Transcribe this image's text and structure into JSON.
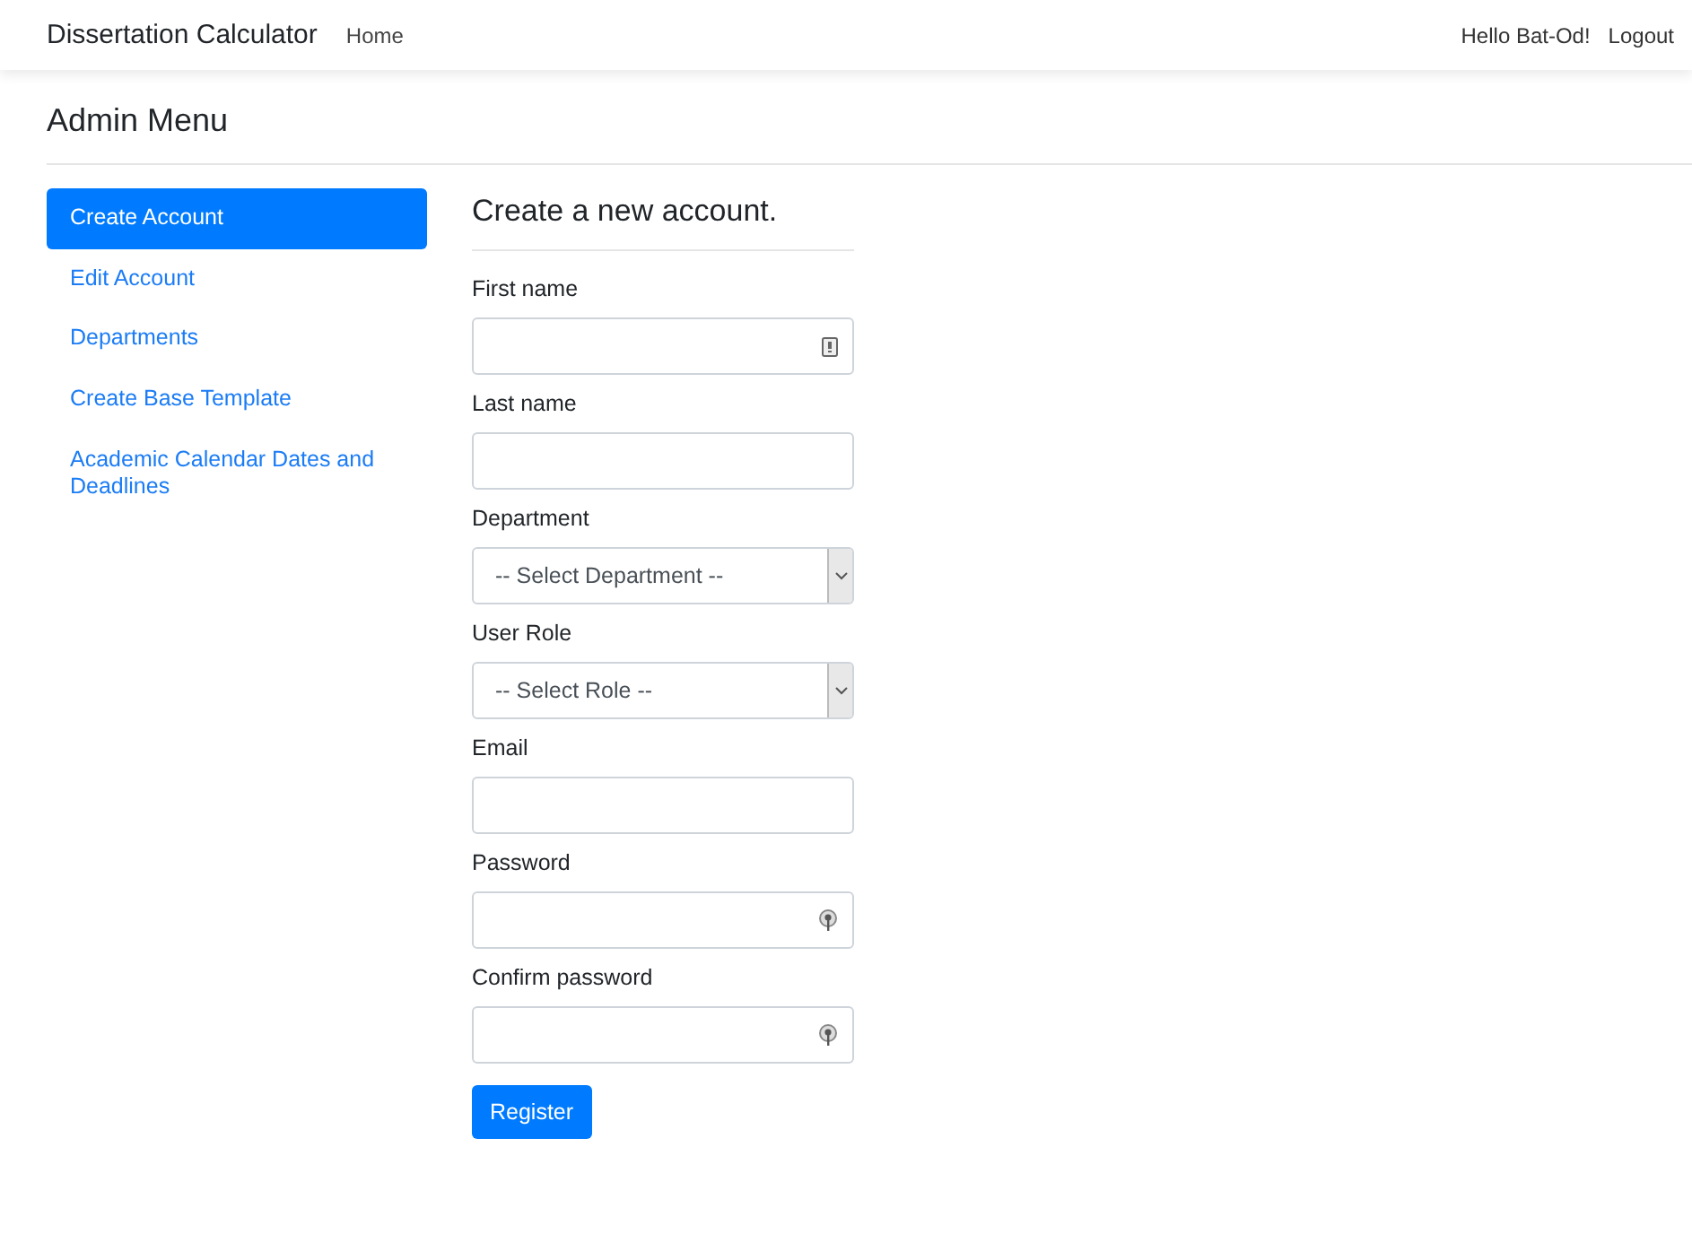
{
  "navbar": {
    "brand": "Dissertation Calculator",
    "links": [
      "Home"
    ],
    "greeting": "Hello Bat-Od!",
    "logout": "Logout"
  },
  "page_title": "Admin Menu",
  "sidebar": {
    "items": [
      {
        "label": "Create Account",
        "selected": true
      },
      {
        "label": "Edit Account",
        "selected": false
      },
      {
        "label": "Departments",
        "selected": false
      },
      {
        "label": "Create Base Template",
        "selected": false
      },
      {
        "label": "Academic Calendar Dates and Deadlines",
        "selected": false
      }
    ]
  },
  "form": {
    "title": "Create a new account.",
    "fields": [
      {
        "label": "First name",
        "kind": "autofill"
      },
      {
        "label": "Last name",
        "kind": "text"
      },
      {
        "label": "Department",
        "kind": "select",
        "placeholder": "-- Select Department --"
      },
      {
        "label": "User Role",
        "kind": "select",
        "placeholder": "-- Select Role --"
      },
      {
        "label": "Email",
        "kind": "text"
      },
      {
        "label": "Password",
        "kind": "password"
      },
      {
        "label": "Confirm password",
        "kind": "password"
      }
    ],
    "submit": "Register"
  }
}
